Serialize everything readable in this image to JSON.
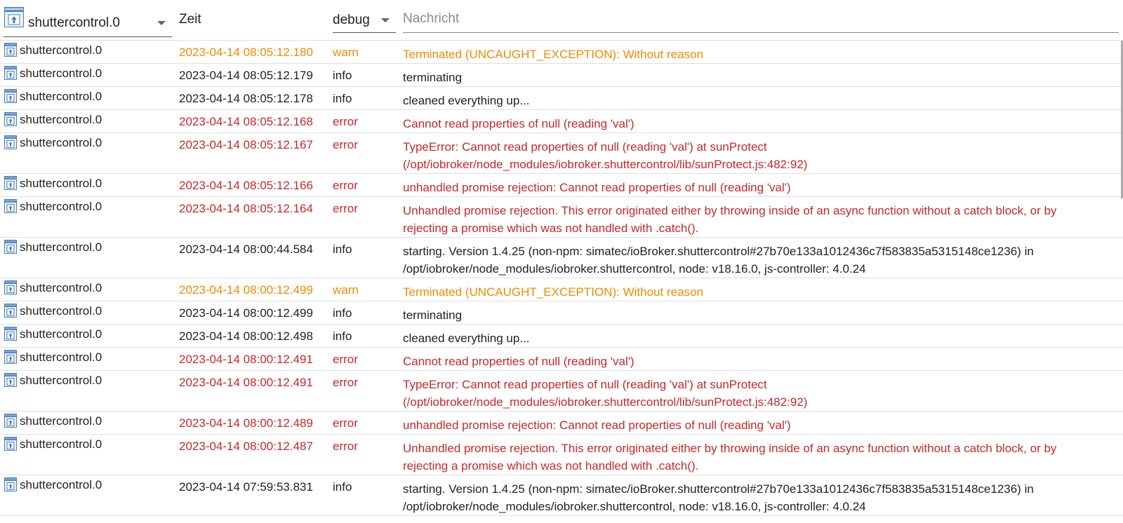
{
  "header": {
    "adapter_filter": "shuttercontrol.0",
    "time_label": "Zeit",
    "level_filter": "debug",
    "message_placeholder": "Nachricht"
  },
  "colors": {
    "warn": "#f08a00",
    "error": "#c62828",
    "info": "#212121"
  },
  "icons": {
    "adapter": "adapter-icon",
    "dropdown": "chevron-down-icon"
  },
  "rows": [
    {
      "source": "shuttercontrol.0",
      "time": "2023-04-14 08:05:12.180",
      "level": "warn",
      "message": "Terminated (UNCAUGHT_EXCEPTION): Without reason",
      "lines": 1
    },
    {
      "source": "shuttercontrol.0",
      "time": "2023-04-14 08:05:12.179",
      "level": "info",
      "message": "terminating",
      "lines": 1
    },
    {
      "source": "shuttercontrol.0",
      "time": "2023-04-14 08:05:12.178",
      "level": "info",
      "message": "cleaned everything up...",
      "lines": 1
    },
    {
      "source": "shuttercontrol.0",
      "time": "2023-04-14 08:05:12.168",
      "level": "error",
      "message": "Cannot read properties of null (reading 'val')",
      "lines": 1
    },
    {
      "source": "shuttercontrol.0",
      "time": "2023-04-14 08:05:12.167",
      "level": "error",
      "message": "TypeError: Cannot read properties of null (reading 'val') at sunProtect (/opt/iobroker/node_modules/iobroker.shuttercontrol/lib/sunProtect.js:482:92)",
      "lines": 2
    },
    {
      "source": "shuttercontrol.0",
      "time": "2023-04-14 08:05:12.166",
      "level": "error",
      "message": "unhandled promise rejection: Cannot read properties of null (reading 'val')",
      "lines": 1
    },
    {
      "source": "shuttercontrol.0",
      "time": "2023-04-14 08:05:12.164",
      "level": "error",
      "message": "Unhandled promise rejection. This error originated either by throwing inside of an async function without a catch block, or by rejecting a promise which was not handled with .catch().",
      "lines": 2
    },
    {
      "source": "shuttercontrol.0",
      "time": "2023-04-14 08:00:44.584",
      "level": "info",
      "message": "starting. Version 1.4.25 (non-npm: simatec/ioBroker.shuttercontrol#27b70e133a1012436c7f583835a5315148ce1236) in /opt/iobroker/node_modules/iobroker.shuttercontrol, node: v18.16.0, js-controller: 4.0.24",
      "lines": 2
    },
    {
      "source": "shuttercontrol.0",
      "time": "2023-04-14 08:00:12.499",
      "level": "warn",
      "message": "Terminated (UNCAUGHT_EXCEPTION): Without reason",
      "lines": 1
    },
    {
      "source": "shuttercontrol.0",
      "time": "2023-04-14 08:00:12.499",
      "level": "info",
      "message": "terminating",
      "lines": 1
    },
    {
      "source": "shuttercontrol.0",
      "time": "2023-04-14 08:00:12.498",
      "level": "info",
      "message": "cleaned everything up...",
      "lines": 1
    },
    {
      "source": "shuttercontrol.0",
      "time": "2023-04-14 08:00:12.491",
      "level": "error",
      "message": "Cannot read properties of null (reading 'val')",
      "lines": 1
    },
    {
      "source": "shuttercontrol.0",
      "time": "2023-04-14 08:00:12.491",
      "level": "error",
      "message": "TypeError: Cannot read properties of null (reading 'val') at sunProtect (/opt/iobroker/node_modules/iobroker.shuttercontrol/lib/sunProtect.js:482:92)",
      "lines": 2
    },
    {
      "source": "shuttercontrol.0",
      "time": "2023-04-14 08:00:12.489",
      "level": "error",
      "message": "unhandled promise rejection: Cannot read properties of null (reading 'val')",
      "lines": 1
    },
    {
      "source": "shuttercontrol.0",
      "time": "2023-04-14 08:00:12.487",
      "level": "error",
      "message": "Unhandled promise rejection. This error originated either by throwing inside of an async function without a catch block, or by rejecting a promise which was not handled with .catch().",
      "lines": 2
    },
    {
      "source": "shuttercontrol.0",
      "time": "2023-04-14 07:59:53.831",
      "level": "info",
      "message": "starting. Version 1.4.25 (non-npm: simatec/ioBroker.shuttercontrol#27b70e133a1012436c7f583835a5315148ce1236) in /opt/iobroker/node_modules/iobroker.shuttercontrol, node: v18.16.0, js-controller: 4.0.24",
      "lines": 2
    }
  ]
}
